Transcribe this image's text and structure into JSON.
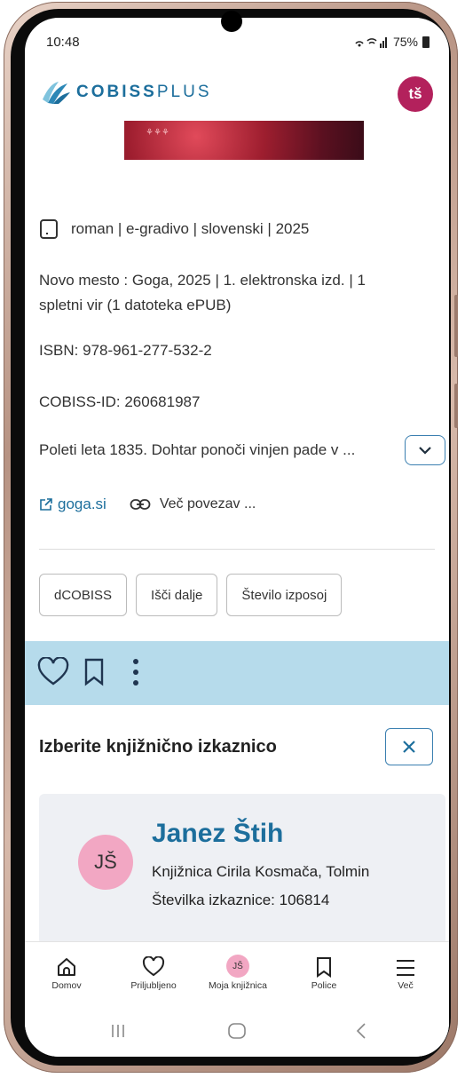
{
  "status_bar": {
    "time": "10:48",
    "battery": "75%"
  },
  "app": {
    "logo_bold": "COBISS",
    "logo_light": "PLUS",
    "user_initials": "tš"
  },
  "record": {
    "type_line": "roman | e-gradivo | slovenski | 2025",
    "publication_line1": "Novo mesto : Goga, 2025 | 1. elektronska izd. | 1",
    "publication_line2": "spletni vir (1 datoteka ePUB)",
    "isbn": "ISBN: 978-961-277-532-2",
    "cobiss_id": "COBISS-ID: 260681987",
    "abstract": "Poleti leta 1835. Dohtar ponoči vinjen pade v ...",
    "external_link": "goga.si",
    "more_links": "Več povezav ..."
  },
  "actions": {
    "dcobiss": "dCOBISS",
    "search_more": "Išči dalje",
    "loans": "Število izposoj"
  },
  "panel": {
    "title": "Izberite knjižnično izkaznico",
    "card": {
      "initials": "JŠ",
      "name": "Janez Štih",
      "library": "Knjižnica Cirila Kosmača, Tolmin",
      "card_number": "Številka izkaznice: 106814"
    }
  },
  "bottom_nav": {
    "home": "Domov",
    "favorites": "Priljubljeno",
    "my_library": "Moja knjižnica",
    "my_library_initials": "JŠ",
    "shelves": "Police",
    "more": "Več"
  },
  "colors": {
    "accent": "#1c6e9c",
    "toolbar_bg": "#b6dbeb",
    "avatar_pink": "#f2a7c3",
    "user_badge": "#b3215c"
  }
}
